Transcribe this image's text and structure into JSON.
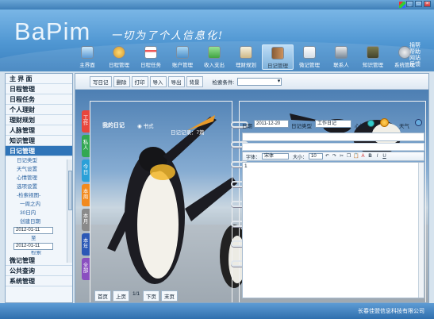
{
  "app": {
    "logo_text": "BaPim",
    "slogan": "一切为了个人信息化!",
    "company": "长春佳盟信息科技有限公司"
  },
  "nav": {
    "items": [
      {
        "label": "主界面",
        "icon": "home-icon"
      },
      {
        "label": "日程管理",
        "icon": "medal-icon"
      },
      {
        "label": "日程任务",
        "icon": "calendar-icon"
      },
      {
        "label": "账户管理",
        "icon": "wallet-icon"
      },
      {
        "label": "收入支出",
        "icon": "money-icon"
      },
      {
        "label": "理财规划",
        "icon": "clipboard-icon"
      },
      {
        "label": "日记管理",
        "icon": "diary-icon",
        "active": true
      },
      {
        "label": "微记管理",
        "icon": "note-icon"
      },
      {
        "label": "联系人",
        "icon": "contacts-icon"
      },
      {
        "label": "知识管理",
        "icon": "book-icon"
      },
      {
        "label": "系统管理",
        "icon": "gear-icon"
      }
    ],
    "right_links": [
      "捐帮",
      "帮助",
      "网站",
      "反馈"
    ]
  },
  "sidebar": {
    "items_top": [
      {
        "label": "主 界 面"
      },
      {
        "label": "日程管理"
      },
      {
        "label": "日程任务"
      },
      {
        "label": "个人理财"
      },
      {
        "label": "理财规划"
      },
      {
        "label": "人脉管理"
      },
      {
        "label": "知识管理"
      },
      {
        "label": "日记管理",
        "active": true
      }
    ],
    "sub_items": [
      {
        "label": "日记类型"
      },
      {
        "label": "天气设置"
      },
      {
        "label": "心情管理"
      },
      {
        "label": "选项设置"
      },
      {
        "label": "-检索视图-"
      },
      {
        "label": "一周之内"
      },
      {
        "label": "30日内"
      },
      {
        "label": "创建日期"
      }
    ],
    "date_from": "2012-01-11",
    "to_label": "至",
    "date_to": "2012-01-11",
    "more_label": "检索",
    "items_bottom": [
      {
        "label": "微记管理"
      },
      {
        "label": "公共查询"
      },
      {
        "label": "系统管理"
      }
    ]
  },
  "toolbar": {
    "buttons": [
      "写日记",
      "删除",
      "打印",
      "导入",
      "导出",
      "背景"
    ],
    "search_label": "检索条件:"
  },
  "diary": {
    "title": "我的日记",
    "format_option": "书式",
    "record_count": "日记记录：7篇",
    "side_tabs": [
      "工作",
      "私人",
      "今日",
      "本周",
      "本月",
      "本年",
      "全部"
    ],
    "side_tab_colors": [
      "#e8463c",
      "#33a853",
      "#2aa0d8",
      "#f28a1e",
      "#8a8a8a",
      "#2b58b6",
      "#8a4fc0"
    ],
    "date_label": "日期",
    "date_value": "2011-12-20",
    "type_label": "日记类型",
    "type_value": "工作日记",
    "mood_label": "心情",
    "weather_label": "天气",
    "editor": {
      "font_label": "字体：",
      "font_value": "宋体",
      "size_label": "大小：",
      "size_value": "10",
      "content": "1"
    },
    "pager": {
      "first": "首页",
      "prev": "上页",
      "page_info": "1/1",
      "next": "下页",
      "last": "末页"
    }
  }
}
